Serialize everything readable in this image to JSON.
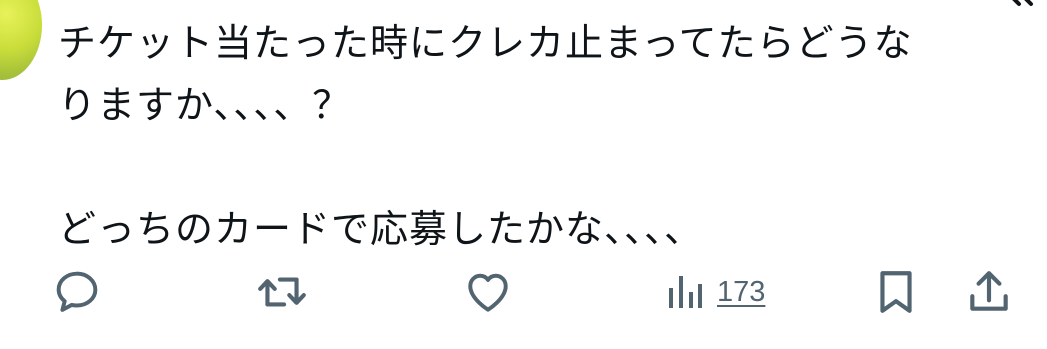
{
  "tweet": {
    "lines": [
      "チケット当たった時にクレカ止まってたらどうな",
      "りますか、、、、？",
      "どっちのカードで応募したかな、、、、"
    ]
  },
  "actions": {
    "reply_icon": "reply-icon",
    "retweet_icon": "retweet-icon",
    "like_icon": "heart-icon",
    "views_icon": "views-chart-icon",
    "views_count": "173",
    "bookmark_icon": "bookmark-icon",
    "share_icon": "share-icon"
  },
  "colors": {
    "text": "#0f1419",
    "icon": "#536471",
    "avatar": "#c9dd3a"
  }
}
